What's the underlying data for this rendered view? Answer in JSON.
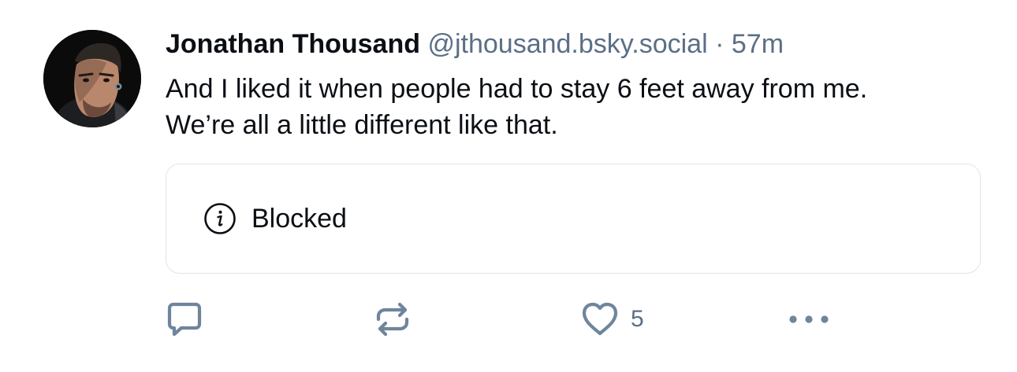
{
  "post": {
    "author": {
      "display_name": "Jonathan Thousand",
      "handle": "@jthousand.bsky.social"
    },
    "separator": "·",
    "timestamp": "57m",
    "text_line_1": "And I liked it when people had to stay 6 feet away from me.",
    "text_line_2": "We’re all a little different like that.",
    "embed": {
      "icon": "info-circle-icon",
      "label": "Blocked"
    },
    "actions": {
      "reply_icon": "speech-bubble-icon",
      "repost_icon": "repost-arrows-icon",
      "like_icon": "heart-icon",
      "like_count": "5",
      "more_icon": "ellipsis-icon"
    }
  },
  "colors": {
    "text_primary": "#0b0f14",
    "text_secondary": "#5b6f85",
    "icon_gray": "#6f859c",
    "embed_border": "#dfe4ea"
  }
}
